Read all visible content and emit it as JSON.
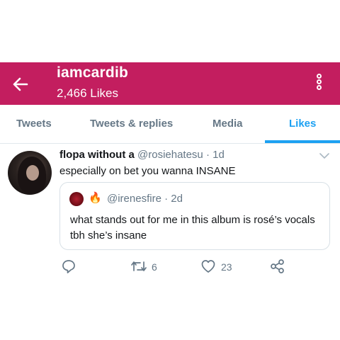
{
  "header": {
    "title": "iamcardib",
    "likes_count": "2,466 Likes",
    "color": "#c31e5f"
  },
  "tabs": [
    {
      "label": "Tweets",
      "active": false
    },
    {
      "label": "Tweets & replies",
      "active": false
    },
    {
      "label": "Media",
      "active": false
    },
    {
      "label": "Likes",
      "active": true
    }
  ],
  "accent_color": "#1da1f2",
  "tweet": {
    "name": "flopa without a",
    "handle": "@rosiehatesu",
    "separator": "·",
    "time": "1d",
    "text": "especially on bet you wanna INSANE",
    "quoted": {
      "emoji": "🔥",
      "handle": "@irenesfire · 2d",
      "text": "what stands out for me in this album is rosé’s vocals tbh she’s insane"
    },
    "actions": {
      "reply_icon": "reply-icon",
      "retweet_icon": "retweet-icon",
      "retweets": "6",
      "like_icon": "heart-icon",
      "likes": "23",
      "share_icon": "share-icon"
    }
  }
}
